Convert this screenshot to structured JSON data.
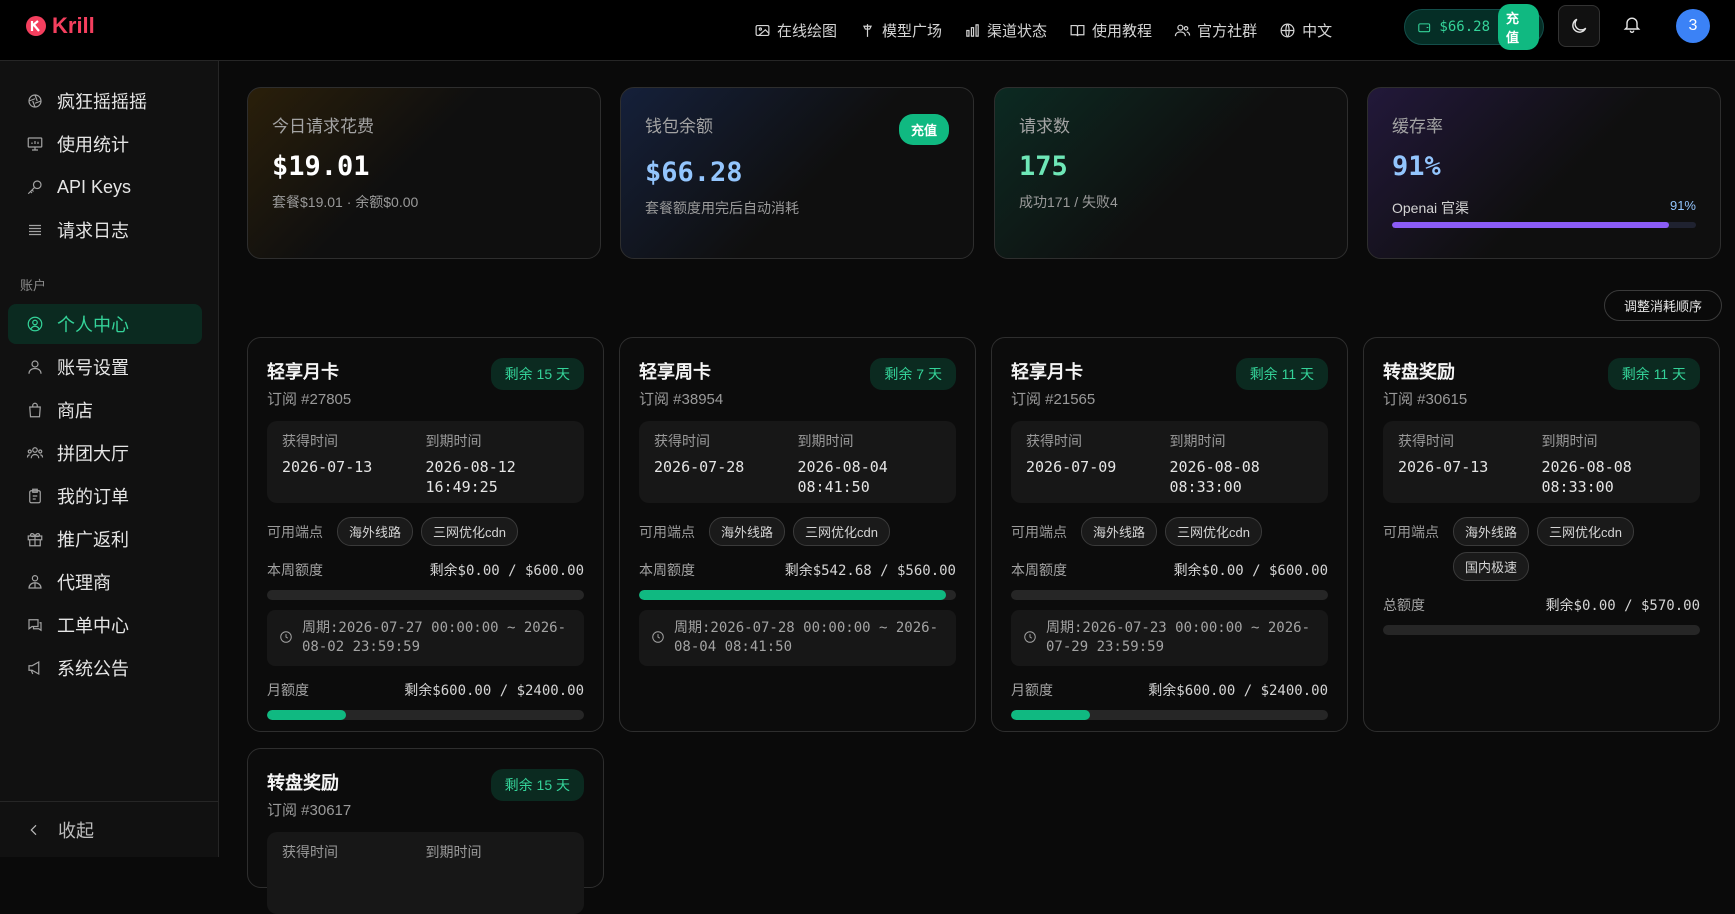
{
  "app": {
    "logo": "Krill"
  },
  "nav": [
    {
      "label": "在线绘图",
      "icon": "image-icon"
    },
    {
      "label": "模型广场",
      "icon": "model-icon"
    },
    {
      "label": "渠道状态",
      "icon": "bar-chart-icon"
    },
    {
      "label": "使用教程",
      "icon": "book-icon"
    },
    {
      "label": "官方社群",
      "icon": "users-icon"
    },
    {
      "label": "中文",
      "icon": "globe-icon"
    }
  ],
  "wallet": {
    "amount": "$66.28",
    "recharge": "充值"
  },
  "user": {
    "avatar": "3"
  },
  "sidebar": {
    "items": [
      {
        "label": "疯狂摇摇摇"
      },
      {
        "label": "使用统计"
      },
      {
        "label": "API Keys"
      },
      {
        "label": "请求日志"
      }
    ],
    "section": "账户",
    "account_items": [
      {
        "label": "个人中心",
        "active": true
      },
      {
        "label": "账号设置"
      },
      {
        "label": "商店"
      },
      {
        "label": "拼团大厅"
      },
      {
        "label": "我的订单"
      },
      {
        "label": "推广返利"
      },
      {
        "label": "代理商"
      },
      {
        "label": "工单中心"
      },
      {
        "label": "系统公告"
      }
    ],
    "collapse": "收起"
  },
  "stats": {
    "today": {
      "label": "今日请求花费",
      "value": "$19.01",
      "sub": "套餐$19.01 · 余额$0.00"
    },
    "balance": {
      "label": "钱包余额",
      "value": "$66.28",
      "sub": "套餐额度用完后自动消耗",
      "chip": "充值"
    },
    "requests": {
      "label": "请求数",
      "value": "175",
      "sub": "成功171 / 失败4"
    },
    "cache": {
      "label": "缓存率",
      "value": "91%",
      "channel": "Openai 官渠",
      "channel_pct": "91%",
      "fill": 0.91
    }
  },
  "adjust_label": "调整消耗顺序",
  "labels": {
    "got": "获得时间",
    "expire": "到期时间",
    "nodes": "可用端点"
  },
  "cards": [
    {
      "title": "轻享月卡",
      "id": "订阅 #27805",
      "badge": "剩余 15 天",
      "got": "2026-07-13",
      "expire": "2026-08-12 16:49:25",
      "tags": [
        "海外线路",
        "三网优化cdn"
      ],
      "week": {
        "label": "本周额度",
        "value": "剩余$0.00 / $600.00",
        "fill": 0.0
      },
      "period": "周期:2026-07-27 00:00:00 ~ 2026-08-02 23:59:59",
      "month": {
        "label": "月额度",
        "value": "剩余$600.00 / $2400.00",
        "fill": 0.25
      }
    },
    {
      "title": "轻享周卡",
      "id": "订阅 #38954",
      "badge": "剩余 7 天",
      "got": "2026-07-28",
      "expire": "2026-08-04 08:41:50",
      "tags": [
        "海外线路",
        "三网优化cdn"
      ],
      "week": {
        "label": "本周额度",
        "value": "剩余$542.68 / $560.00",
        "fill": 0.97
      },
      "period": "周期:2026-07-28 00:00:00 ~ 2026-08-04 08:41:50"
    },
    {
      "title": "轻享月卡",
      "id": "订阅 #21565",
      "badge": "剩余 11 天",
      "got": "2026-07-09",
      "expire": "2026-08-08 08:33:00",
      "tags": [
        "海外线路",
        "三网优化cdn"
      ],
      "week": {
        "label": "本周额度",
        "value": "剩余$0.00 / $600.00",
        "fill": 0.0
      },
      "period": "周期:2026-07-23 00:00:00 ~ 2026-07-29 23:59:59",
      "month": {
        "label": "月额度",
        "value": "剩余$600.00 / $2400.00",
        "fill": 0.25
      }
    },
    {
      "title": "转盘奖励",
      "id": "订阅 #30615",
      "badge": "剩余 11 天",
      "got": "2026-07-13",
      "expire": "2026-08-08 08:33:00",
      "tags": [
        "海外线路",
        "三网优化cdn",
        "国内极速"
      ],
      "total": {
        "label": "总额度",
        "value": "剩余$0.00 / $570.00",
        "fill": 0.0
      }
    },
    {
      "title": "转盘奖励",
      "id": "订阅 #30617",
      "badge": "剩余 15 天"
    }
  ],
  "colors": {
    "accent": "#10b981",
    "cache_bar": "#8b5cf6",
    "avatar": "#3b82f6"
  }
}
